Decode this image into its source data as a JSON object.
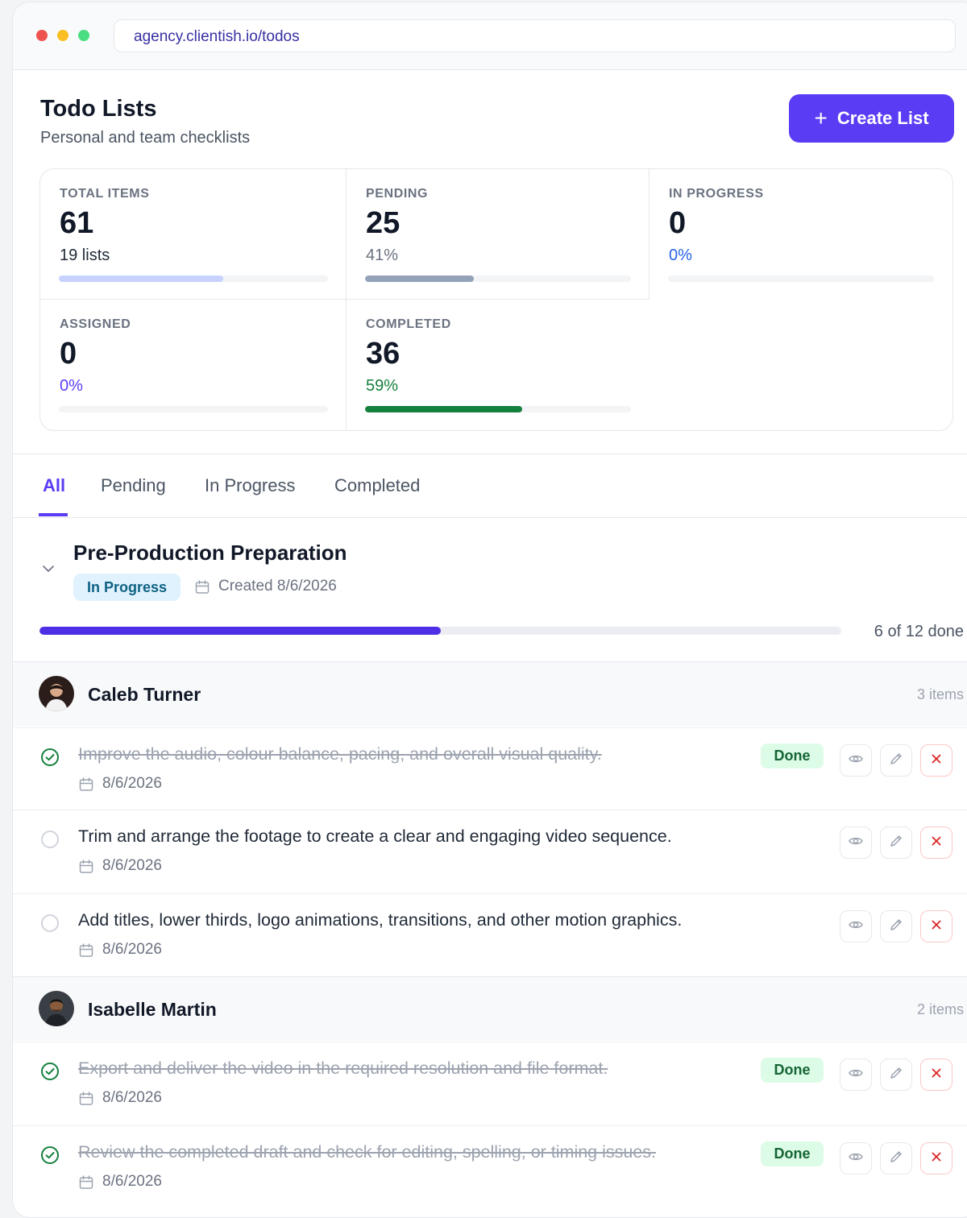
{
  "browser": {
    "url": "agency.clientish.io/todos"
  },
  "header": {
    "title": "Todo Lists",
    "subtitle": "Personal and team checklists",
    "create_label": "Create List",
    "accent": "#5b3cf5"
  },
  "stats": {
    "total": {
      "label": "TOTAL ITEMS",
      "value": "61",
      "sub": "19 lists",
      "progress": 0.61,
      "color": "#c7d2fe"
    },
    "pending": {
      "label": "PENDING",
      "value": "25",
      "sub": "41%",
      "progress": 0.41,
      "color": "#94a3b8"
    },
    "in_progress": {
      "label": "IN PROGRESS",
      "value": "0",
      "sub": "0%",
      "progress": 0,
      "color": "#2563eb"
    },
    "assigned": {
      "label": "ASSIGNED",
      "value": "0",
      "sub": "0%",
      "progress": 0,
      "color": "#5b3cf5"
    },
    "completed": {
      "label": "COMPLETED",
      "value": "36",
      "sub": "59%",
      "progress": 0.59,
      "color": "#15803d"
    }
  },
  "tabs": [
    "All",
    "Pending",
    "In Progress",
    "Completed"
  ],
  "list": {
    "title": "Pre-Production Preparation",
    "status": "In Progress",
    "created": "Created 8/6/2026",
    "progress": 0.5,
    "done_text": "6 of 12 done",
    "groups": [
      {
        "name": "Caleb Turner",
        "count": "3 items",
        "items": [
          {
            "text": "Improve the audio, colour balance, pacing, and overall visual quality.",
            "date": "8/6/2026",
            "done": true,
            "badge": "Done"
          },
          {
            "text": "Trim and arrange the footage to create a clear and engaging video sequence.",
            "date": "8/6/2026",
            "done": false
          },
          {
            "text": "Add titles, lower thirds, logo animations, transitions, and other motion graphics.",
            "date": "8/6/2026",
            "done": false
          }
        ]
      },
      {
        "name": "Isabelle Martin",
        "count": "2 items",
        "items": [
          {
            "text": "Export and deliver the video in the required resolution and file format.",
            "date": "8/6/2026",
            "done": true,
            "badge": "Done"
          },
          {
            "text": "Review the completed draft and check for editing, spelling, or timing issues.",
            "date": "8/6/2026",
            "done": true,
            "badge": "Done"
          }
        ]
      }
    ]
  }
}
